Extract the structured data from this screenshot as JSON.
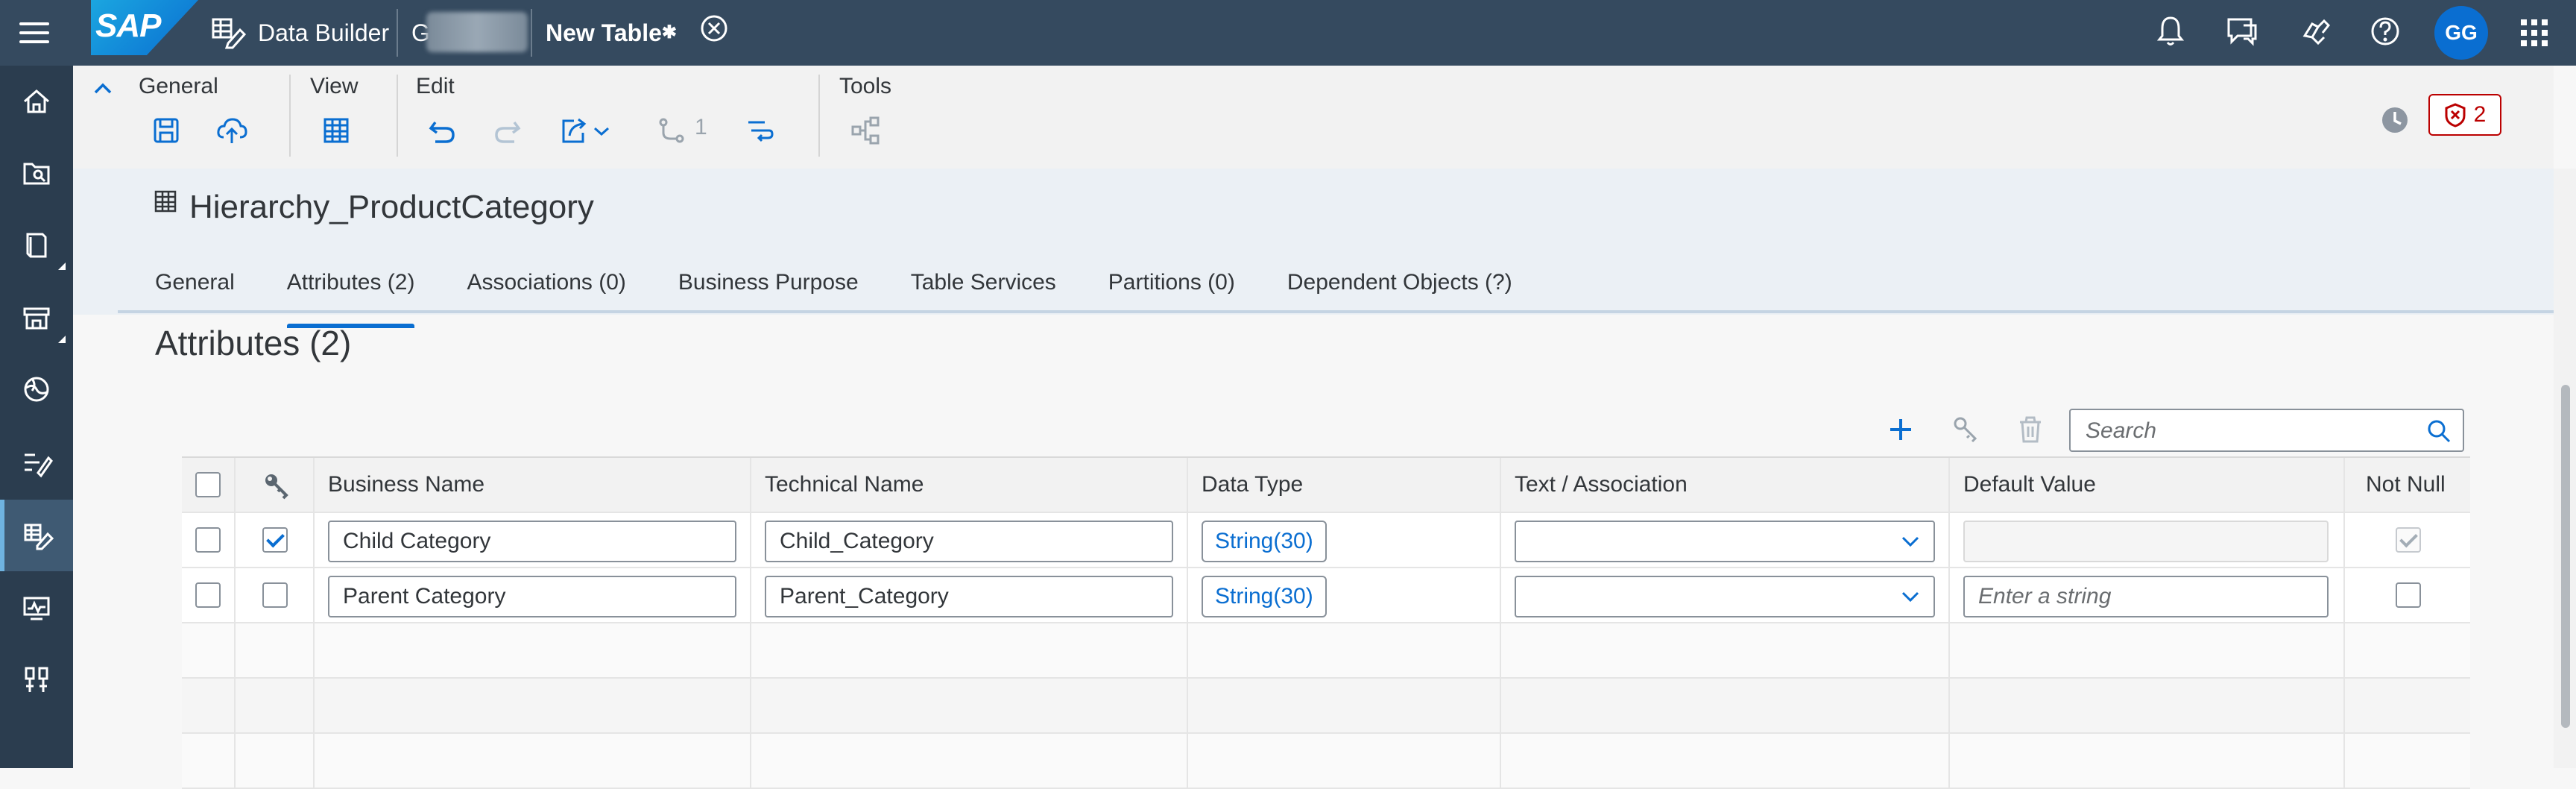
{
  "shell": {
    "app_name": "Data Builder",
    "space_initial": "G",
    "title": "New Table",
    "avatar": "GG",
    "logo_text": "SAP"
  },
  "toolbar": {
    "general_label": "General",
    "view_label": "View",
    "edit_label": "Edit",
    "tools_label": "Tools",
    "impact_count": "1",
    "error_count": "2"
  },
  "object": {
    "name": "Hierarchy_ProductCategory"
  },
  "tabs": [
    {
      "label": "General"
    },
    {
      "label": "Attributes (2)"
    },
    {
      "label": "Associations (0)"
    },
    {
      "label": "Business Purpose"
    },
    {
      "label": "Table Services"
    },
    {
      "label": "Partitions (0)"
    },
    {
      "label": "Dependent Objects (?)"
    }
  ],
  "section": {
    "title": "Attributes (2)"
  },
  "search": {
    "placeholder": "Search"
  },
  "table": {
    "columns": [
      "Business Name",
      "Technical Name",
      "Data Type",
      "Text / Association",
      "Default Value",
      "Not Null"
    ],
    "rows": [
      {
        "selected": false,
        "key": true,
        "business_name": "Child Category",
        "technical_name": "Child_Category",
        "data_type": "String(30)",
        "text_association": "",
        "default_value": "",
        "not_null": true
      },
      {
        "selected": false,
        "key": false,
        "business_name": "Parent Category",
        "technical_name": "Parent_Category",
        "data_type": "String(30)",
        "text_association": "",
        "default_value_placeholder": "Enter a string",
        "not_null": false
      }
    ]
  },
  "colors": {
    "shell_bg": "#354a5f",
    "accent": "#0a6ed1",
    "error": "#bb0000"
  }
}
